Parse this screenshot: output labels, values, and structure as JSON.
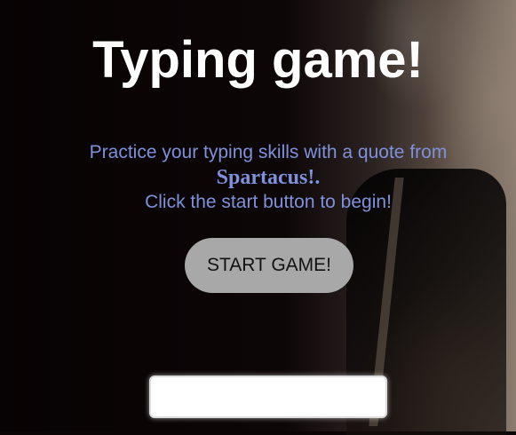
{
  "header": {
    "title": "Typing game!"
  },
  "intro": {
    "line1": "Practice your typing skills with a quote from",
    "source": "Spartacus!.",
    "line3": "Click the start button to begin!"
  },
  "controls": {
    "start_label": "START GAME!",
    "input_value": ""
  },
  "colors": {
    "text_accent": "#7f91da",
    "button_bg": "#a8a8a8",
    "title": "#ffffff"
  }
}
